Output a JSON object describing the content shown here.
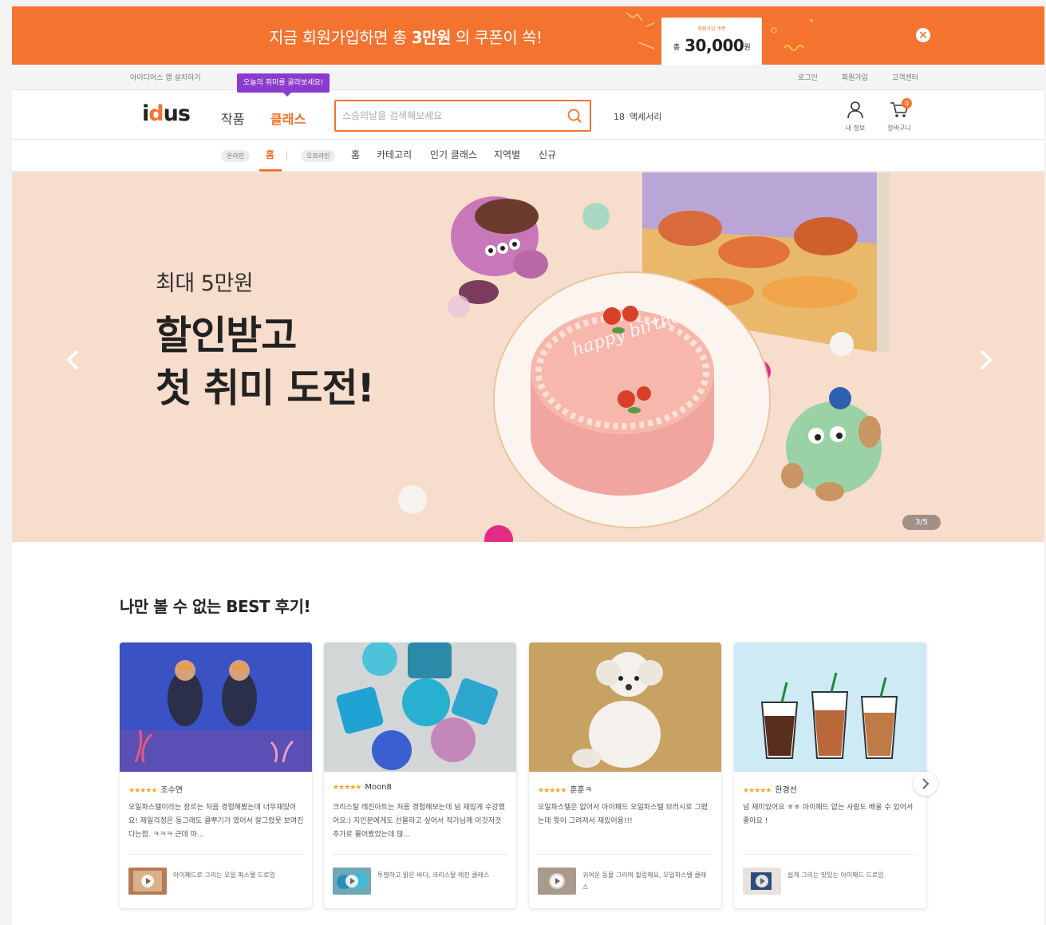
{
  "promo": {
    "text_before": "지금 회원가입하면 총 ",
    "text_bold": "3만원",
    "text_after": " 의 쿠폰이 쏙!",
    "coupon_label": "회원가입 쿠폰",
    "coupon_prefix": "총",
    "coupon_amount": "30,000",
    "coupon_unit": "원",
    "close_icon": "close-icon",
    "color": "#f3732f"
  },
  "utility": {
    "install_app": "아이디어스 앱 설치하기",
    "links": [
      "로그인",
      "회원가입",
      "고객센터"
    ]
  },
  "header": {
    "logo_prefix": "i",
    "logo_d": "d",
    "logo_suffix": "us",
    "nav_works": "작품",
    "nav_class": "클래스",
    "tooltip": "오늘의 취미를 골라보세요!",
    "search_placeholder": "스승의날을 검색해보세요",
    "trend_rank": "18",
    "trend_keyword": "액세서리",
    "my_info": "내 정보",
    "cart": "장바구니",
    "cart_count": "0"
  },
  "subnav": {
    "online_chip": "온라인",
    "online_home": "홈",
    "offline_chip": "오프라인",
    "offline_home": "홈",
    "items": [
      "카테고리",
      "인기 클래스",
      "지역별",
      "신규"
    ]
  },
  "hero": {
    "subtitle": "최대 5만원",
    "title_line1": "할인받고",
    "title_line2": "첫 취미 도전!",
    "counter": "3/5",
    "cake_text": "happy birthday"
  },
  "reviews": {
    "title": "나만 볼 수 없는 BEST 후기!",
    "cards": [
      {
        "stars": "★★★★★",
        "author": "조수연",
        "text": "오일파스텔이라는 장르는 처음 경험해봤는데 너무재밌어요! 제일걱정은 동그래도 클뿌기가 였어서 잘그렸못 보여진다는점. ㅋㅋㅋ 근데 마...",
        "class_title": "아이패드로 그리는 오일 파스텔 드로잉"
      },
      {
        "stars": "★★★★★",
        "author": "Moon8",
        "text": "크리스탈 레진아트는 처음 경험해보는데 넘 재밌게 수강했어요:) 지인분에게도 선물하고 싶어서 작가님께 이것저것 추가로 물어봤었는데 많...",
        "class_title": "투명하고 맑은 바다, 크리스탈 레진 클래스"
      },
      {
        "stars": "★★★★★",
        "author": "훈훈ㅋ",
        "text": "오일파스텔은 없어서 아이패드 오일파스텔 브러시로 그렸는데 뭣이 그려져서 재밌어용!!!",
        "class_title": "귀여운 동물 그리며 힐링해요, 오일파스텔 클래스"
      },
      {
        "stars": "★★★★★",
        "author": "한경선",
        "text": "넘 재미있어요 ㅎㅎ 아이패드 없는 사람도 배울 수 있어서 좋아요 !",
        "class_title": "쉽게 그리는 맛있는 아이패드 드로잉"
      }
    ]
  }
}
